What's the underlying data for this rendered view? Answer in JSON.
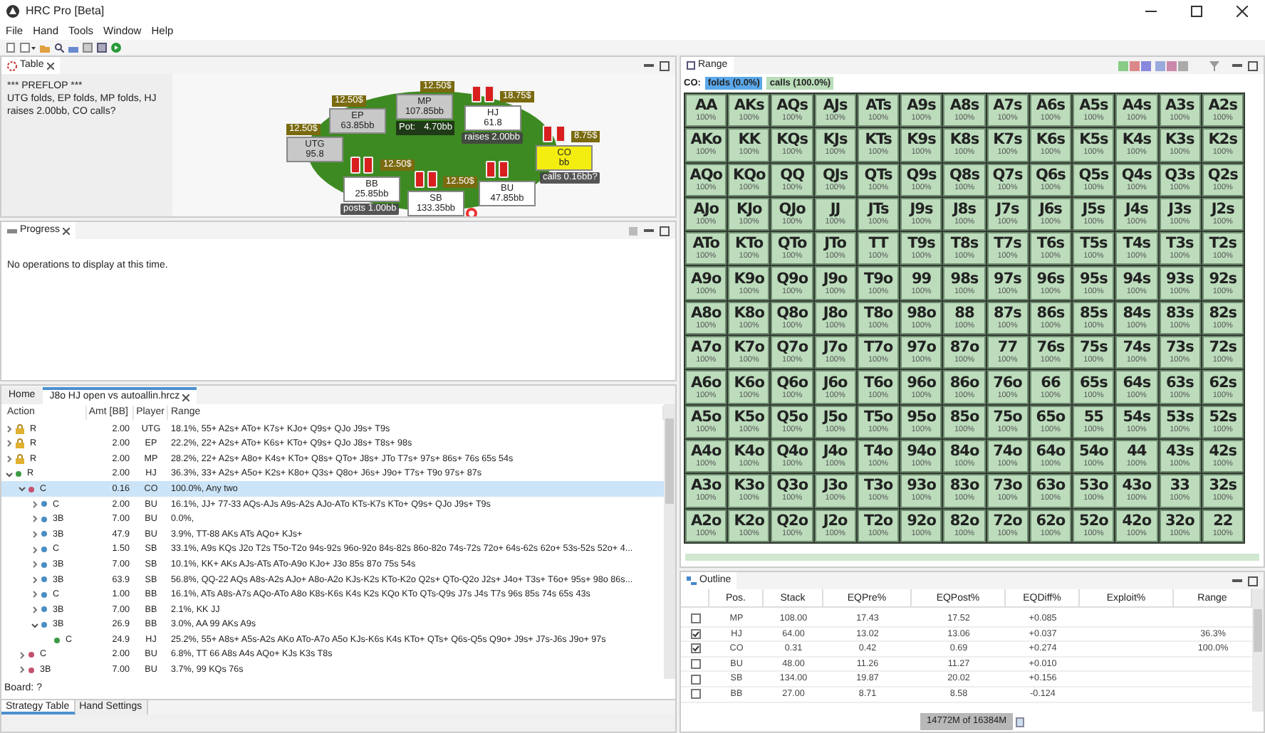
{
  "window": {
    "title": "HRC Pro [Beta]"
  },
  "menu": [
    "File",
    "Hand",
    "Tools",
    "Window",
    "Help"
  ],
  "table_view": {
    "tab": "Table",
    "log": [
      "*** PREFLOP ***",
      "UTG folds, EP folds, MP folds, HJ raises 2.00bb, CO calls?"
    ],
    "pot": {
      "label": "Pot:",
      "value": "4.70bb"
    },
    "seats": [
      {
        "position": "UTG",
        "stack": "95.8",
        "bet": "12.50$",
        "folded": true,
        "highlighted": false
      },
      {
        "position": "EP",
        "stack": "63.85bb",
        "bet": "12.50$",
        "folded": true,
        "highlighted": false
      },
      {
        "position": "MP",
        "stack": "107.85bb",
        "bet": "12.50$",
        "folded": true,
        "highlighted": false
      },
      {
        "position": "HJ",
        "stack": "61.8",
        "bet": "18.75$",
        "action": "raises 2.00bb",
        "folded": false,
        "highlighted": false
      },
      {
        "position": "CO",
        "stack": "bb",
        "bet": "8.75$",
        "action": "calls 0.16bb?",
        "folded": false,
        "highlighted": true
      },
      {
        "position": "BB",
        "stack": "25.85bb",
        "bet": "12.50$",
        "action": "posts 1.00bb",
        "folded": false,
        "highlighted": false
      },
      {
        "position": "SB",
        "stack": "133.35bb",
        "bet": "12.50$",
        "folded": false,
        "highlighted": false
      },
      {
        "position": "BU",
        "stack": "47.85bb",
        "folded": false,
        "highlighted": false
      }
    ]
  },
  "progress_view": {
    "tab": "Progress",
    "message": "No operations to display at this time."
  },
  "editor": {
    "tabs": [
      {
        "label": "Home",
        "selected": false,
        "closable": false
      },
      {
        "label": "J8o HJ open vs autoallin.hrcz",
        "selected": true,
        "closable": true
      }
    ],
    "columns": [
      "Action",
      "Amt [BB]",
      "Player",
      "Range"
    ],
    "rows": [
      {
        "action": "R",
        "amount": "2.00",
        "player": "UTG",
        "range": "18.1%, 55+ A2s+ ATo+ K7s+ KJo+ Q9s+ QJo J9s+ T9s",
        "leaf": false,
        "expanded": false,
        "locked": true,
        "selected": false
      },
      {
        "action": "R",
        "amount": "2.00",
        "player": "EP",
        "range": "22.2%, 22+ A2s+ ATo+ K6s+ KTo+ Q9s+ QJo J8s+ T8s+ 98s",
        "leaf": false,
        "expanded": false,
        "locked": true,
        "selected": false
      },
      {
        "action": "R",
        "amount": "2.00",
        "player": "MP",
        "range": "28.2%, 22+ A2s+ A8o+ K4s+ KTo+ Q8s+ QTo+ J8s+ JTo T7s+ 97s+ 86s+ 76s 65s 54s",
        "leaf": false,
        "expanded": false,
        "locked": true,
        "selected": false
      },
      {
        "action": "R",
        "amount": "2.00",
        "player": "HJ",
        "range": "36.3%, 33+ A2s+ A5o+ K2s+ K8o+ Q3s+ Q8o+ J6s+ J9o+ T7s+ T9o 97s+ 87s",
        "leaf": false,
        "expanded": true,
        "locked": false,
        "color": "#3c9a46",
        "selected": false,
        "children": [
          {
            "action": "C",
            "amount": "0.16",
            "player": "CO",
            "range": "100.0%, Any two",
            "leaf": false,
            "expanded": true,
            "locked": false,
            "color": "#c4506e",
            "selected": true,
            "children": [
              {
                "action": "C",
                "amount": "2.00",
                "player": "BU",
                "range": "16.1%, JJ+ 77-33 AQs-AJs A9s-A2s AJo-ATo KTs-K7s KTo+ Q9s+ QJo J9s+ T9s",
                "leaf": false,
                "expanded": false,
                "locked": false,
                "color": "#4a8ec4",
                "selected": false
              },
              {
                "action": "3B",
                "amount": "7.00",
                "player": "BU",
                "range": "0.0%,",
                "leaf": false,
                "expanded": false,
                "locked": false,
                "color": "#4a8ec4",
                "selected": false
              },
              {
                "action": "3B",
                "amount": "47.9",
                "player": "BU",
                "range": "3.9%, TT-88 AKs ATs AQo+ KJs+",
                "leaf": false,
                "expanded": false,
                "locked": false,
                "color": "#4a8ec4",
                "selected": false
              },
              {
                "action": "C",
                "amount": "1.50",
                "player": "SB",
                "range": "33.1%, A9s KQs J2o T2s T5o-T2o 94s-92s 96o-92o 84s-82s 86o-82o 74s-72s 72o+ 64s-62s 62o+ 53s-52s 52o+ 4...",
                "leaf": false,
                "expanded": false,
                "locked": false,
                "color": "#4a8ec4",
                "selected": false
              },
              {
                "action": "3B",
                "amount": "7.00",
                "player": "SB",
                "range": "10.1%, KK+ AKs AJs-ATs ATo-A9o KJo+ J3o 85s 87o 75s 54s",
                "leaf": false,
                "expanded": false,
                "locked": false,
                "color": "#4a8ec4",
                "selected": false
              },
              {
                "action": "3B",
                "amount": "63.9",
                "player": "SB",
                "range": "56.8%, QQ-22 AQs A8s-A2s AJo+ A8o-A2o KJs-K2s KTo-K2o Q2s+ QTo-Q2o J2s+ J4o+ T3s+ T6o+ 95s+ 98o 86s...",
                "leaf": false,
                "expanded": false,
                "locked": false,
                "color": "#4a8ec4",
                "selected": false
              },
              {
                "action": "C",
                "amount": "1.00",
                "player": "BB",
                "range": "16.1%, ATs A8s-A7s AQo-ATo A8o K8s-K6s K4s K2s KQo KTo QTs-Q9s J7s J4s T7s 96s 85s 74s 65s 43s",
                "leaf": false,
                "expanded": false,
                "locked": false,
                "color": "#4a8ec4",
                "selected": false
              },
              {
                "action": "3B",
                "amount": "7.00",
                "player": "BB",
                "range": "2.1%, KK JJ",
                "leaf": false,
                "expanded": false,
                "locked": false,
                "color": "#4a8ec4",
                "selected": false
              },
              {
                "action": "3B",
                "amount": "26.9",
                "player": "BB",
                "range": "3.0%, AA 99 AKs A9s",
                "leaf": false,
                "expanded": true,
                "locked": false,
                "color": "#4a8ec4",
                "selected": false,
                "children": [
                  {
                    "action": "C",
                    "amount": "24.9",
                    "player": "HJ",
                    "range": "25.2%, 55+ A8s+ A5s-A2s AKo ATo-A7o A5o KJs-K6s K4s KTo+ QTs+ Q6s-Q5s Q9o+ J9s+ J7s-J6s J9o+ 97s",
                    "leaf": true,
                    "locked": false,
                    "color": "#3c9a46",
                    "selected": false
                  }
                ]
              }
            ]
          },
          {
            "action": "C",
            "amount": "2.00",
            "player": "BU",
            "range": "6.8%, TT 66 A8s A4s AQo+ KJs K3s T8s",
            "leaf": false,
            "expanded": false,
            "locked": false,
            "color": "#c4506e",
            "selected": false
          },
          {
            "action": "3B",
            "amount": "7.00",
            "player": "BU",
            "range": "3.7%, 99 KQs 76s",
            "leaf": false,
            "expanded": false,
            "locked": false,
            "color": "#c4506e",
            "selected": false
          }
        ]
      }
    ],
    "board": "Board: ?",
    "bottom_tabs": [
      {
        "label": "Strategy Table",
        "selected": true
      },
      {
        "label": "Hand Settings",
        "selected": false
      }
    ]
  },
  "range_view": {
    "tab": "Range",
    "player": "CO:",
    "legend": [
      {
        "label": "folds (0.0%)",
        "color": "#5aa8ea"
      },
      {
        "label": "calls (100.0%)",
        "color": "#b9dcb9"
      }
    ],
    "rows": [
      {
        "hands": [
          "AA",
          "AKs",
          "AQs",
          "AJs",
          "ATs",
          "A9s",
          "A8s",
          "A7s",
          "A6s",
          "A5s",
          "A4s",
          "A3s",
          "A2s"
        ],
        "freqs": [
          "100%",
          "100%",
          "100%",
          "100%",
          "100%",
          "100%",
          "100%",
          "100%",
          "100%",
          "100%",
          "100%",
          "100%",
          "100%"
        ]
      },
      {
        "hands": [
          "AKo",
          "KK",
          "KQs",
          "KJs",
          "KTs",
          "K9s",
          "K8s",
          "K7s",
          "K6s",
          "K5s",
          "K4s",
          "K3s",
          "K2s"
        ],
        "freqs": [
          "100%",
          "100%",
          "100%",
          "100%",
          "100%",
          "100%",
          "100%",
          "100%",
          "100%",
          "100%",
          "100%",
          "100%",
          "100%"
        ]
      },
      {
        "hands": [
          "AQo",
          "KQo",
          "QQ",
          "QJs",
          "QTs",
          "Q9s",
          "Q8s",
          "Q7s",
          "Q6s",
          "Q5s",
          "Q4s",
          "Q3s",
          "Q2s"
        ],
        "freqs": [
          "100%",
          "100%",
          "100%",
          "100%",
          "100%",
          "100%",
          "100%",
          "100%",
          "100%",
          "100%",
          "100%",
          "100%",
          "100%"
        ]
      },
      {
        "hands": [
          "AJo",
          "KJo",
          "QJo",
          "JJ",
          "JTs",
          "J9s",
          "J8s",
          "J7s",
          "J6s",
          "J5s",
          "J4s",
          "J3s",
          "J2s"
        ],
        "freqs": [
          "100%",
          "100%",
          "100%",
          "100%",
          "100%",
          "100%",
          "100%",
          "100%",
          "100%",
          "100%",
          "100%",
          "100%",
          "100%"
        ]
      },
      {
        "hands": [
          "ATo",
          "KTo",
          "QTo",
          "JTo",
          "TT",
          "T9s",
          "T8s",
          "T7s",
          "T6s",
          "T5s",
          "T4s",
          "T3s",
          "T2s"
        ],
        "freqs": [
          "100%",
          "100%",
          "100%",
          "100%",
          "100%",
          "100%",
          "100%",
          "100%",
          "100%",
          "100%",
          "100%",
          "100%",
          "100%"
        ]
      },
      {
        "hands": [
          "A9o",
          "K9o",
          "Q9o",
          "J9o",
          "T9o",
          "99",
          "98s",
          "97s",
          "96s",
          "95s",
          "94s",
          "93s",
          "92s"
        ],
        "freqs": [
          "100%",
          "100%",
          "100%",
          "100%",
          "100%",
          "100%",
          "100%",
          "100%",
          "100%",
          "100%",
          "100%",
          "100%",
          "100%"
        ]
      },
      {
        "hands": [
          "A8o",
          "K8o",
          "Q8o",
          "J8o",
          "T8o",
          "98o",
          "88",
          "87s",
          "86s",
          "85s",
          "84s",
          "83s",
          "82s"
        ],
        "freqs": [
          "100%",
          "100%",
          "100%",
          "100%",
          "100%",
          "100%",
          "100%",
          "100%",
          "100%",
          "100%",
          "100%",
          "100%",
          "100%"
        ]
      },
      {
        "hands": [
          "A7o",
          "K7o",
          "Q7o",
          "J7o",
          "T7o",
          "97o",
          "87o",
          "77",
          "76s",
          "75s",
          "74s",
          "73s",
          "72s"
        ],
        "freqs": [
          "100%",
          "100%",
          "100%",
          "100%",
          "100%",
          "100%",
          "100%",
          "100%",
          "100%",
          "100%",
          "100%",
          "100%",
          "100%"
        ]
      },
      {
        "hands": [
          "A6o",
          "K6o",
          "Q6o",
          "J6o",
          "T6o",
          "96o",
          "86o",
          "76o",
          "66",
          "65s",
          "64s",
          "63s",
          "62s"
        ],
        "freqs": [
          "100%",
          "100%",
          "100%",
          "100%",
          "100%",
          "100%",
          "100%",
          "100%",
          "100%",
          "100%",
          "100%",
          "100%",
          "100%"
        ]
      },
      {
        "hands": [
          "A5o",
          "K5o",
          "Q5o",
          "J5o",
          "T5o",
          "95o",
          "85o",
          "75o",
          "65o",
          "55",
          "54s",
          "53s",
          "52s"
        ],
        "freqs": [
          "100%",
          "100%",
          "100%",
          "100%",
          "100%",
          "100%",
          "100%",
          "100%",
          "100%",
          "100%",
          "100%",
          "100%",
          "100%"
        ]
      },
      {
        "hands": [
          "A4o",
          "K4o",
          "Q4o",
          "J4o",
          "T4o",
          "94o",
          "84o",
          "74o",
          "64o",
          "54o",
          "44",
          "43s",
          "42s"
        ],
        "freqs": [
          "100%",
          "100%",
          "100%",
          "100%",
          "100%",
          "100%",
          "100%",
          "100%",
          "100%",
          "100%",
          "100%",
          "100%",
          "100%"
        ]
      },
      {
        "hands": [
          "A3o",
          "K3o",
          "Q3o",
          "J3o",
          "T3o",
          "93o",
          "83o",
          "73o",
          "63o",
          "53o",
          "43o",
          "33",
          "32s"
        ],
        "freqs": [
          "100%",
          "100%",
          "100%",
          "100%",
          "100%",
          "100%",
          "100%",
          "100%",
          "100%",
          "100%",
          "100%",
          "100%",
          "100%"
        ]
      },
      {
        "hands": [
          "A2o",
          "K2o",
          "Q2o",
          "J2o",
          "T2o",
          "92o",
          "82o",
          "72o",
          "62o",
          "52o",
          "42o",
          "32o",
          "22"
        ],
        "freqs": [
          "100%",
          "100%",
          "100%",
          "100%",
          "100%",
          "100%",
          "100%",
          "100%",
          "100%",
          "100%",
          "100%",
          "100%",
          "100%"
        ]
      }
    ]
  },
  "outline_view": {
    "tab": "Outline",
    "columns": [
      "Pos.",
      "Stack",
      "EQPre%",
      "EQPost%",
      "EQDiff%",
      "Exploit%",
      "Range"
    ],
    "rows": [
      {
        "checked": false,
        "cells": [
          "MP",
          "108.00",
          "17.43",
          "17.52",
          "+0.085",
          null,
          null
        ]
      },
      {
        "checked": true,
        "cells": [
          "HJ",
          "64.00",
          "13.02",
          "13.06",
          "+0.037",
          null,
          "36.3%"
        ]
      },
      {
        "checked": true,
        "cells": [
          "CO",
          "0.31",
          "0.42",
          "0.69",
          "+0.274",
          null,
          "100.0%"
        ]
      },
      {
        "checked": false,
        "cells": [
          "BU",
          "48.00",
          "11.26",
          "11.27",
          "+0.010",
          null,
          null
        ]
      },
      {
        "checked": false,
        "cells": [
          "SB",
          "134.00",
          "19.87",
          "20.02",
          "+0.156",
          null,
          null
        ]
      },
      {
        "checked": false,
        "cells": [
          "BB",
          "27.00",
          "8.71",
          "8.58",
          "-0.124",
          null,
          null
        ]
      }
    ],
    "memory": "14772M of 16384M"
  }
}
